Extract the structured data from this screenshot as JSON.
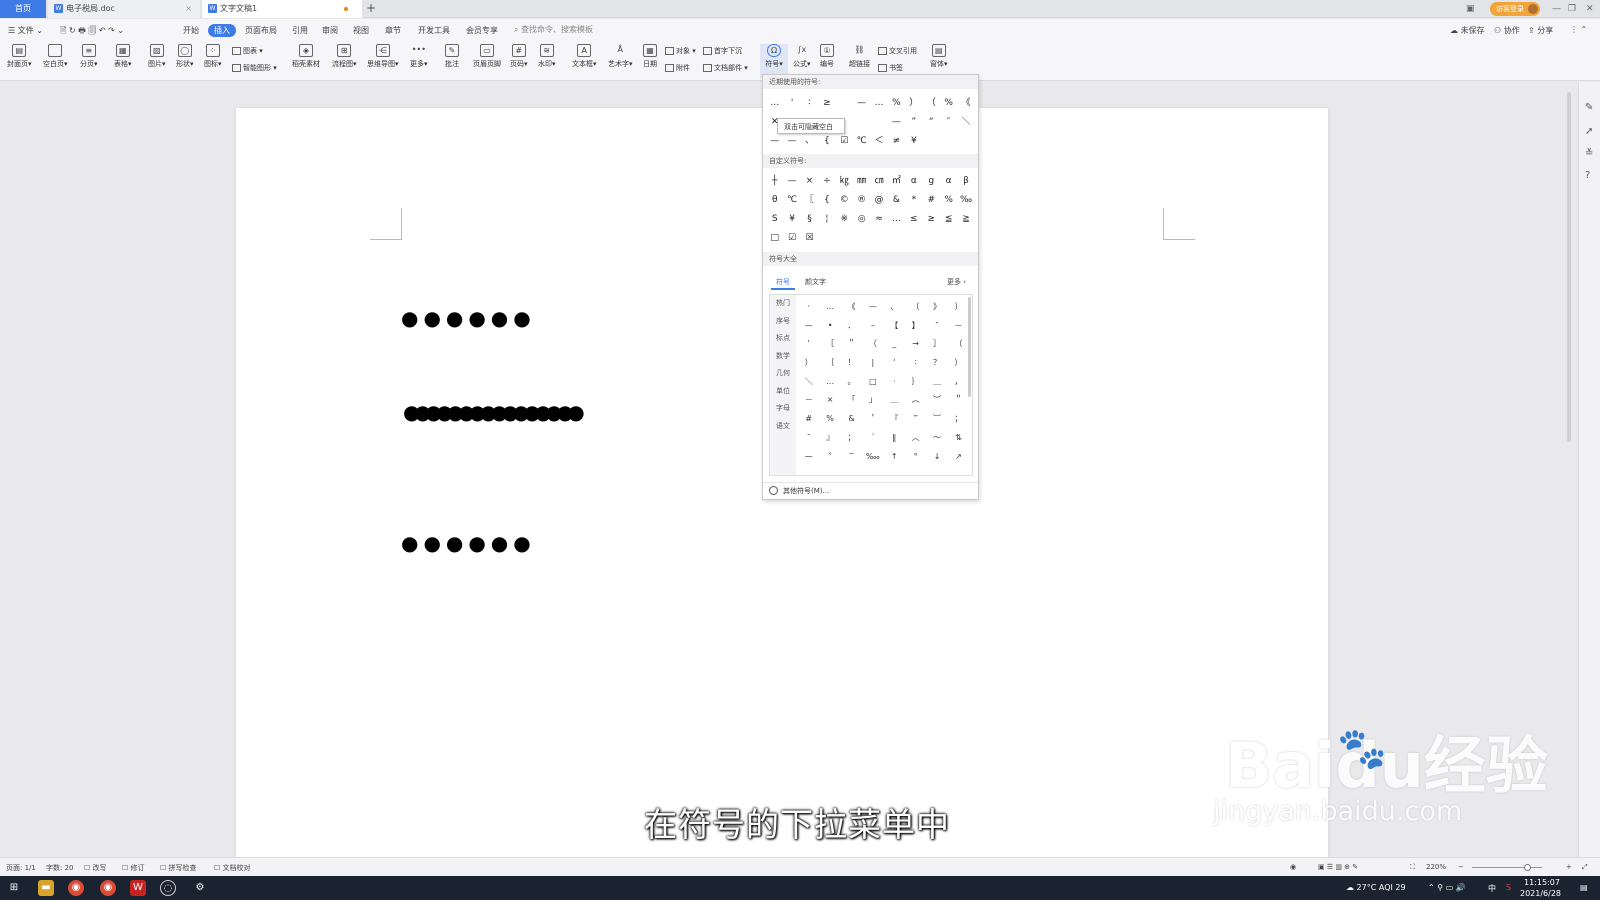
{
  "tabs": {
    "home": "首页",
    "doc1": "电子税局.doc",
    "doc2": "文字文稿1",
    "wps_icon": "W"
  },
  "titlebar": {
    "login": "访客登录"
  },
  "menu": {
    "file": "文件",
    "items": [
      "开始",
      "插入",
      "页面布局",
      "引用",
      "审阅",
      "视图",
      "章节",
      "开发工具",
      "会员专享"
    ],
    "search": "查找命令、搜索模板",
    "unsaved": "未保存",
    "collab": "协作",
    "share": "分享"
  },
  "ribbon": {
    "buttons": [
      "封面页",
      "空白页",
      "分页",
      "表格",
      "图片",
      "形状",
      "图标",
      "稻壳素材",
      "流程图",
      "思维导图",
      "更多",
      "批注",
      "页眉页脚",
      "页码",
      "水印",
      "文本框",
      "艺术字",
      "日期",
      "符号",
      "公式",
      "编号",
      "超链接",
      "窗体"
    ],
    "small": [
      "图表",
      "智能图形",
      "对象",
      "首字下沉",
      "附件",
      "文档部件",
      "交叉引用",
      "书签"
    ]
  },
  "document": {
    "dots1": "●●●●●●",
    "dots2": "●●●●●●●●●●●●●●●●",
    "dots3": "●●●●●●"
  },
  "symbol_menu": {
    "recent_title": "近期使用的符号:",
    "recent": [
      "…",
      "'",
      "∶",
      "≥",
      "",
      "—",
      "…",
      "%",
      "）",
      "（",
      "%",
      "《",
      "✕",
      "双击可隐藏空白",
      "",
      "",
      "",
      "",
      "",
      "—",
      "”",
      "“",
      "″",
      "＼",
      "—",
      "—",
      "、",
      "{",
      "☑",
      "℃",
      "＜",
      "≠",
      "¥"
    ],
    "tooltip": "双击可隐藏空白",
    "custom_title": "自定义符号:",
    "custom": [
      "┼",
      "—",
      "×",
      "÷",
      "㎏",
      "㎜",
      "㎝",
      "㎡",
      "α",
      "g",
      "α",
      "β",
      "θ",
      "℃",
      "〖",
      "{",
      "©",
      "®",
      "@",
      "&",
      "*",
      "#",
      "%",
      "‰",
      "S",
      "¥",
      "§",
      "¦",
      "※",
      "◎",
      "≈",
      "…",
      "≤",
      "≥",
      "≦",
      "≧",
      "□",
      "☑",
      "☒"
    ],
    "all_title": "符号大全",
    "tab_symbol": "符号",
    "tab_yanwenzi": "颜文字",
    "more": "更多 ›",
    "categories": [
      "热门",
      "序号",
      "标点",
      "数学",
      "几何",
      "单位",
      "字母",
      "语文"
    ],
    "all": [
      "·",
      "…",
      "《",
      "—",
      "、",
      "〔",
      "》",
      "〕",
      "—",
      "•",
      "．",
      "–",
      "【",
      "】",
      "″",
      "－",
      "'",
      "［",
      "＂",
      "（",
      "_",
      "→",
      "］",
      "（",
      "）",
      "｛",
      "！",
      "|",
      "‘",
      "∶",
      "？",
      "）",
      "＼",
      "…",
      "。",
      "□",
      "·",
      "｝",
      "＿",
      "，",
      "－",
      "×",
      "「",
      "」",
      "＿",
      "︵",
      "︶",
      "＂",
      "#",
      "%",
      "&",
      "＇",
      "『",
      "‴",
      "︺",
      "；",
      "¯",
      "』",
      "；",
      "´",
      "‖",
      "︿",
      "～",
      "⇅",
      "⁓",
      "˂",
      "‾",
      "‱",
      "↑",
      "°",
      "↓",
      "↗"
    ],
    "other": "其他符号(M)..."
  },
  "subtitle": "在符号的下拉菜单中",
  "watermark": {
    "big": "Baidu经验",
    "small": "jingyan.baidu.com"
  },
  "status": {
    "page": "页面: 1/1",
    "words": "字数: 20",
    "rewrite": "改写",
    "revise": "修订",
    "spell": "拼写检查",
    "proof": "文档校对",
    "zoom": "220%"
  },
  "taskbar": {
    "weather": "27°C AQI 29",
    "ime": "中",
    "time": "11:15:07",
    "date": "2021/6/28"
  }
}
